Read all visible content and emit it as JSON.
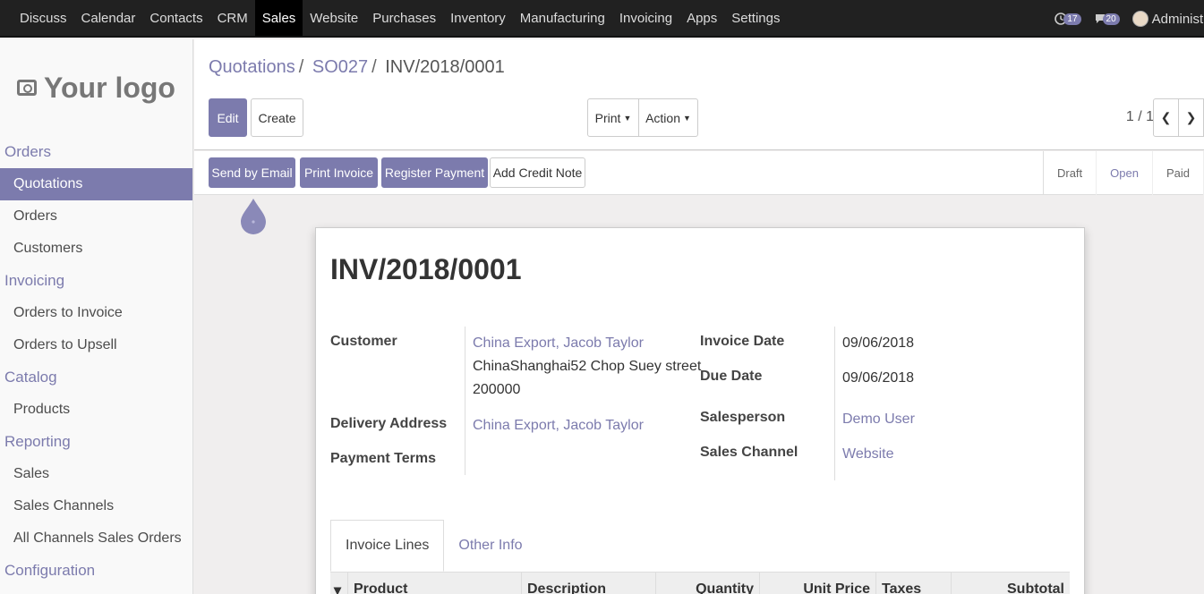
{
  "topbar": {
    "menu": [
      "Discuss",
      "Calendar",
      "Contacts",
      "CRM",
      "Sales",
      "Website",
      "Purchases",
      "Inventory",
      "Manufacturing",
      "Invoicing",
      "Apps",
      "Settings"
    ],
    "active_index": 4,
    "activity_count": "17",
    "message_count": "20",
    "user": "Administrator"
  },
  "sidebar": {
    "logo": "Your logo",
    "sections": [
      {
        "title": "Orders",
        "items": [
          "Quotations",
          "Orders",
          "Customers"
        ]
      },
      {
        "title": "Invoicing",
        "items": [
          "Orders to Invoice",
          "Orders to Upsell"
        ]
      },
      {
        "title": "Catalog",
        "items": [
          "Products"
        ]
      },
      {
        "title": "Reporting",
        "items": [
          "Sales",
          "Sales Channels",
          "All Channels Sales Orders"
        ]
      },
      {
        "title": "Configuration",
        "items": []
      }
    ]
  },
  "breadcrumb": {
    "first": "Quotations",
    "second": "SO027",
    "current": "INV/2018/0001"
  },
  "buttons": {
    "edit": "Edit",
    "create": "Create",
    "print": "Print",
    "action": "Action"
  },
  "pager": "1 / 1",
  "statusbar": {
    "send_email": "Send by Email",
    "print_invoice": "Print Invoice",
    "register_payment": "Register Payment",
    "add_credit_note": "Add Credit Note",
    "stages": [
      "Draft",
      "Open",
      "Paid"
    ],
    "current_stage": "Open"
  },
  "invoice": {
    "title": "INV/2018/0001",
    "customer_label": "Customer",
    "customer": "China Export, Jacob Taylor",
    "address_line1": "ChinaShanghai52 Chop Suey street",
    "address_line2": "200000",
    "delivery_label": "Delivery Address",
    "delivery": "China Export, Jacob Taylor",
    "payment_terms_label": "Payment Terms",
    "invoice_date_label": "Invoice Date",
    "invoice_date": "09/06/2018",
    "due_date_label": "Due Date",
    "due_date": "09/06/2018",
    "salesperson_label": "Salesperson",
    "salesperson": "Demo User",
    "sales_channel_label": "Sales Channel",
    "sales_channel": "Website"
  },
  "tabs": [
    "Invoice Lines",
    "Other Info"
  ],
  "table_headers": [
    "Product",
    "Description",
    "Quantity",
    "Unit Price",
    "Taxes",
    "Subtotal"
  ]
}
